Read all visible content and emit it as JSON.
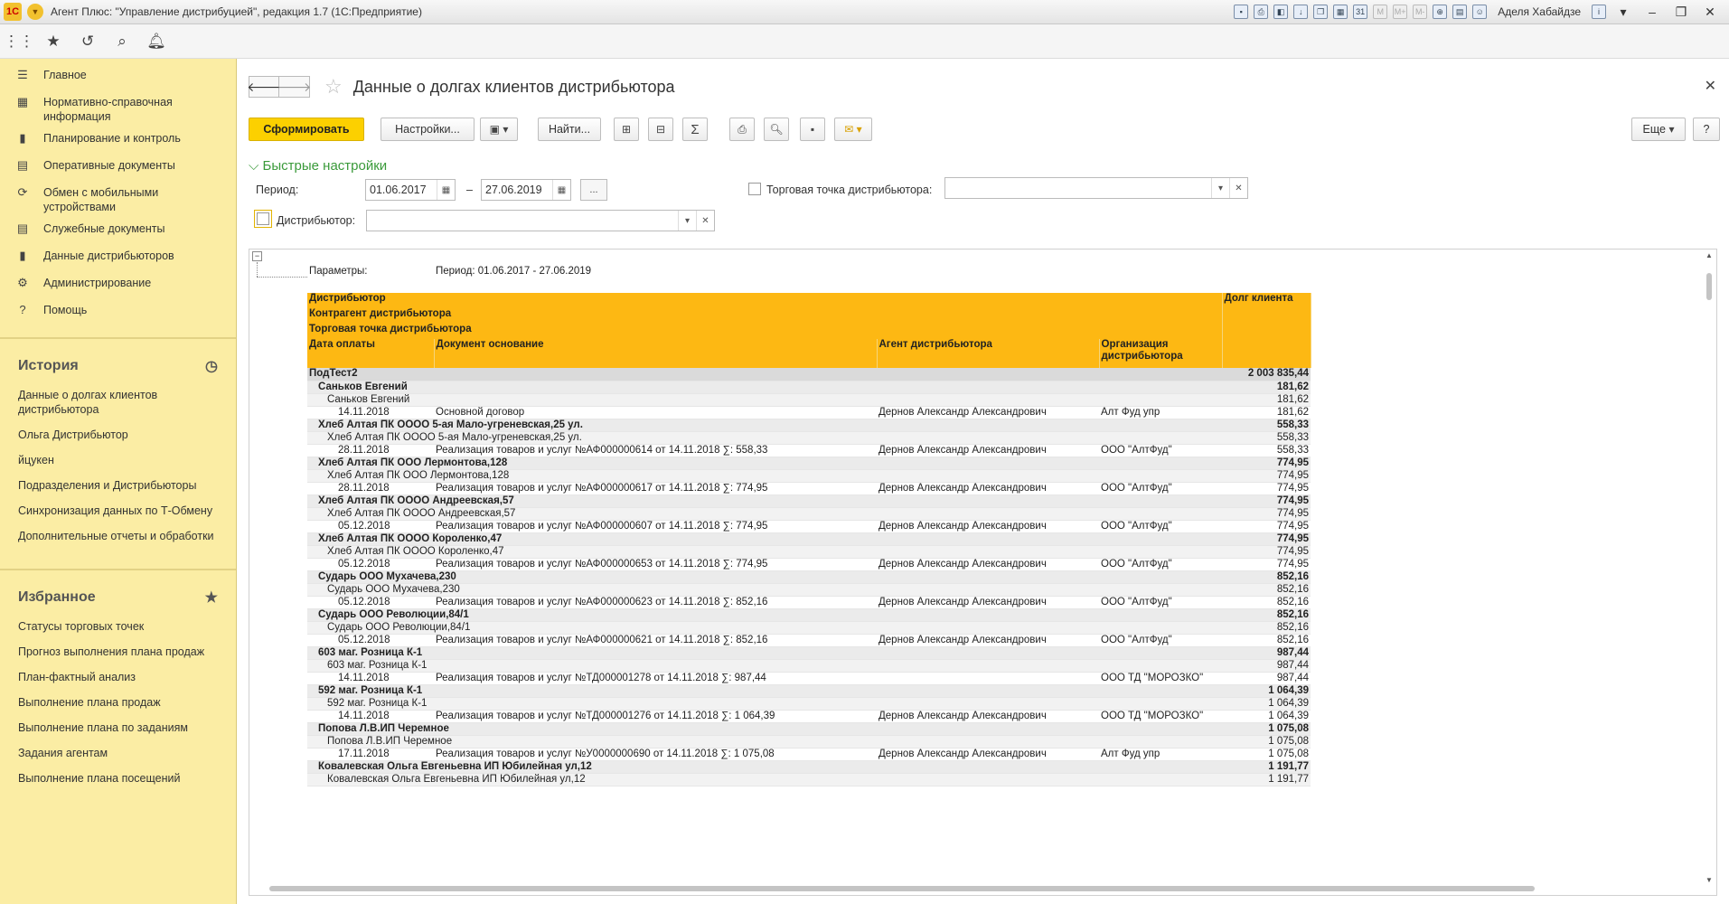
{
  "window": {
    "title": "Агент Плюс: \"Управление дистрибуцией\", редакция 1.7  (1С:Предприятие)",
    "user": "Аделя Хабайдзе"
  },
  "sidebar": {
    "nav": [
      {
        "icon": "menu-icon",
        "label": "Главное"
      },
      {
        "icon": "grid-icon",
        "label": "Нормативно-справочная информация"
      },
      {
        "icon": "chart-icon",
        "label": "Планирование и контроль"
      },
      {
        "icon": "doc-icon",
        "label": "Оперативные документы"
      },
      {
        "icon": "sync-icon",
        "label": "Обмен с мобильными устройствами"
      },
      {
        "icon": "doc-icon",
        "label": "Служебные документы"
      },
      {
        "icon": "chart-icon",
        "label": "Данные дистрибьюторов"
      },
      {
        "icon": "gear-icon",
        "label": "Администрирование"
      },
      {
        "icon": "help-icon",
        "label": "Помощь"
      }
    ],
    "history_title": "История",
    "history": [
      "Данные о долгах клиентов дистрибьютора",
      "Ольга Дистрибьютор",
      "йцукен",
      "Подразделения и Дистрибьюторы",
      "Синхронизация данных по Т-Обмену",
      "Дополнительные отчеты и обработки"
    ],
    "favorites_title": "Избранное",
    "favorites": [
      "Статусы торговых точек",
      "Прогноз выполнения плана продаж",
      "План-фактный анализ",
      "Выполнение плана продаж",
      "Выполнение плана по заданиям",
      "Задания агентам",
      "Выполнение плана посещений"
    ]
  },
  "page": {
    "title": "Данные о долгах клиентов дистрибьютора"
  },
  "toolbar": {
    "generate": "Сформировать",
    "settings": "Настройки...",
    "find": "Найти...",
    "more": "Еще",
    "help": "?"
  },
  "quick": {
    "title": "Быстрые настройки",
    "period_label": "Период:",
    "date_from": "01.06.2017",
    "dash": "–",
    "date_to": "27.06.2019",
    "dots": "...",
    "outlet_label": "Торговая точка дистрибьютора:",
    "distributor_label": "Дистрибьютор:"
  },
  "report": {
    "params_label": "Параметры:",
    "params_value": "Период: 01.06.2017 - 27.06.2019",
    "headers": {
      "distributor": "Дистрибьютор",
      "counterparty": "Контрагент дистрибьютора",
      "outlet": "Торговая точка дистрибьютора",
      "date": "Дата оплаты",
      "doc": "Документ основание",
      "agent": "Агент дистрибьютора",
      "org": "Организация дистрибьютора",
      "debt": "Долг клиента"
    },
    "rows": [
      {
        "lvl": 0,
        "text": "ПодТест2",
        "sum": "2 003 835,44"
      },
      {
        "lvl": 1,
        "text": "Саньков Евгений",
        "sum": "181,62"
      },
      {
        "lvl": 2,
        "text": "Саньков Евгений",
        "sum": "181,62"
      },
      {
        "lvl": 3,
        "date": "14.11.2018",
        "doc": "Основной договор",
        "agent": "Дернов Александр Александрович",
        "org": "Алт Фуд упр",
        "sum": "181,62"
      },
      {
        "lvl": 1,
        "text": "Хлеб Алтая ПК ОООО 5-ая Мало-угреневская,25 ул.",
        "sum": "558,33"
      },
      {
        "lvl": 2,
        "text": "Хлеб Алтая ПК ОООО 5-ая Мало-угреневская,25 ул.",
        "sum": "558,33"
      },
      {
        "lvl": 3,
        "date": "28.11.2018",
        "doc": "Реализация товаров и услуг №АФ000000614 от 14.11.2018 ∑: 558,33",
        "agent": "Дернов Александр Александрович",
        "org": "ООО \"АлтФуд\"",
        "sum": "558,33"
      },
      {
        "lvl": 1,
        "text": "Хлеб Алтая ПК ООО Лермонтова,128",
        "sum": "774,95"
      },
      {
        "lvl": 2,
        "text": "Хлеб Алтая ПК ООО Лермонтова,128",
        "sum": "774,95"
      },
      {
        "lvl": 3,
        "date": "28.11.2018",
        "doc": "Реализация товаров и услуг №АФ000000617 от 14.11.2018 ∑: 774,95",
        "agent": "Дернов Александр Александрович",
        "org": "ООО \"АлтФуд\"",
        "sum": "774,95"
      },
      {
        "lvl": 1,
        "text": "Хлеб Алтая ПК ОООО Андреевская,57",
        "sum": "774,95"
      },
      {
        "lvl": 2,
        "text": "Хлеб Алтая ПК ОООО Андреевская,57",
        "sum": "774,95"
      },
      {
        "lvl": 3,
        "date": "05.12.2018",
        "doc": "Реализация товаров и услуг №АФ000000607 от 14.11.2018 ∑: 774,95",
        "agent": "Дернов Александр Александрович",
        "org": "ООО \"АлтФуд\"",
        "sum": "774,95"
      },
      {
        "lvl": 1,
        "text": "Хлеб Алтая ПК ОООО Короленко,47",
        "sum": "774,95"
      },
      {
        "lvl": 2,
        "text": "Хлеб Алтая ПК ОООО Короленко,47",
        "sum": "774,95"
      },
      {
        "lvl": 3,
        "date": "05.12.2018",
        "doc": "Реализация товаров и услуг №АФ000000653 от 14.11.2018 ∑: 774,95",
        "agent": "Дернов Александр Александрович",
        "org": "ООО \"АлтФуд\"",
        "sum": "774,95"
      },
      {
        "lvl": 1,
        "text": "Сударь ООО Мухачева,230",
        "sum": "852,16"
      },
      {
        "lvl": 2,
        "text": "Сударь ООО Мухачева,230",
        "sum": "852,16"
      },
      {
        "lvl": 3,
        "date": "05.12.2018",
        "doc": "Реализация товаров и услуг №АФ000000623 от 14.11.2018 ∑: 852,16",
        "agent": "Дернов Александр Александрович",
        "org": "ООО \"АлтФуд\"",
        "sum": "852,16"
      },
      {
        "lvl": 1,
        "text": "Сударь ООО Революции,84/1",
        "sum": "852,16"
      },
      {
        "lvl": 2,
        "text": "Сударь ООО Революции,84/1",
        "sum": "852,16"
      },
      {
        "lvl": 3,
        "date": "05.12.2018",
        "doc": "Реализация товаров и услуг №АФ000000621 от 14.11.2018 ∑: 852,16",
        "agent": "Дернов Александр Александрович",
        "org": "ООО \"АлтФуд\"",
        "sum": "852,16"
      },
      {
        "lvl": 1,
        "text": "603 маг. Розница К-1",
        "sum": "987,44"
      },
      {
        "lvl": 2,
        "text": "603 маг. Розница К-1",
        "sum": "987,44"
      },
      {
        "lvl": 3,
        "date": "14.11.2018",
        "doc": "Реализация товаров и услуг №ТД000001278 от 14.11.2018 ∑: 987,44",
        "agent": "",
        "org": "ООО ТД \"МОРОЗКО\"",
        "sum": "987,44"
      },
      {
        "lvl": 1,
        "text": "592 маг. Розница К-1",
        "sum": "1 064,39"
      },
      {
        "lvl": 2,
        "text": "592 маг. Розница К-1",
        "sum": "1 064,39"
      },
      {
        "lvl": 3,
        "date": "14.11.2018",
        "doc": "Реализация товаров и услуг №ТД000001276 от 14.11.2018 ∑: 1 064,39",
        "agent": "Дернов Александр Александрович",
        "org": "ООО ТД \"МОРОЗКО\"",
        "sum": "1 064,39"
      },
      {
        "lvl": 1,
        "text": "Попова Л.В.ИП Черемное",
        "sum": "1 075,08"
      },
      {
        "lvl": 2,
        "text": "Попова Л.В.ИП Черемное",
        "sum": "1 075,08"
      },
      {
        "lvl": 3,
        "date": "17.11.2018",
        "doc": "Реализация товаров и услуг №У0000000690 от 14.11.2018 ∑: 1 075,08",
        "agent": "Дернов Александр Александрович",
        "org": "Алт Фуд упр",
        "sum": "1 075,08"
      },
      {
        "lvl": 1,
        "text": "Ковалевская Ольга Евгеньевна ИП Юбилейная ул,12",
        "sum": "1 191,77"
      },
      {
        "lvl": 2,
        "text": "Ковалевская Ольга Евгеньевна ИП Юбилейная ул,12",
        "sum": "1 191,77"
      }
    ]
  }
}
